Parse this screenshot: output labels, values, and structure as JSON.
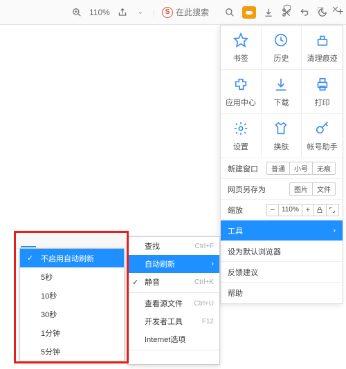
{
  "toolbar": {
    "zoom_text": "110%",
    "search_placeholder": "在此搜索"
  },
  "window": {},
  "panel": {
    "grid": [
      {
        "label": "书签"
      },
      {
        "label": "历史"
      },
      {
        "label": "清理痕迹"
      },
      {
        "label": "应用中心"
      },
      {
        "label": "下载"
      },
      {
        "label": "打印"
      },
      {
        "label": "设置"
      },
      {
        "label": "换肤"
      },
      {
        "label": "帐号助手"
      }
    ],
    "row_newwin": {
      "label": "新建窗口",
      "opts": [
        "普通",
        "小号",
        "无痕"
      ]
    },
    "row_saveas": {
      "label": "网页另存为",
      "opts": [
        "图片",
        "文件"
      ]
    },
    "row_zoom": {
      "label": "缩放",
      "value": "110%"
    },
    "row_tools": {
      "label": "工具"
    },
    "row_default": {
      "label": "设为默认浏览器"
    },
    "row_feedback": {
      "label": "反馈建议"
    },
    "row_help": {
      "label": "帮助"
    }
  },
  "submenu": {
    "items": [
      {
        "label": "查找",
        "shortcut": "Ctrl+F"
      },
      {
        "label": "自动刷新",
        "hi": true,
        "arrow": true
      },
      {
        "label": "静音",
        "shortcut": "Ctrl+K",
        "check": true
      },
      {
        "sep": true
      },
      {
        "label": "查看源文件",
        "shortcut": "Ctrl+U"
      },
      {
        "label": "开发者工具",
        "shortcut": "F12"
      },
      {
        "label": "Internet选项"
      },
      {
        "label": "",
        "disabled": true
      }
    ]
  },
  "subsub": {
    "items": [
      {
        "label": "不启用自动刷新",
        "hi": true,
        "check": true
      },
      {
        "label": "5秒"
      },
      {
        "label": "10秒"
      },
      {
        "label": "30秒"
      },
      {
        "label": "1分钟"
      },
      {
        "label": "5分钟"
      }
    ]
  }
}
